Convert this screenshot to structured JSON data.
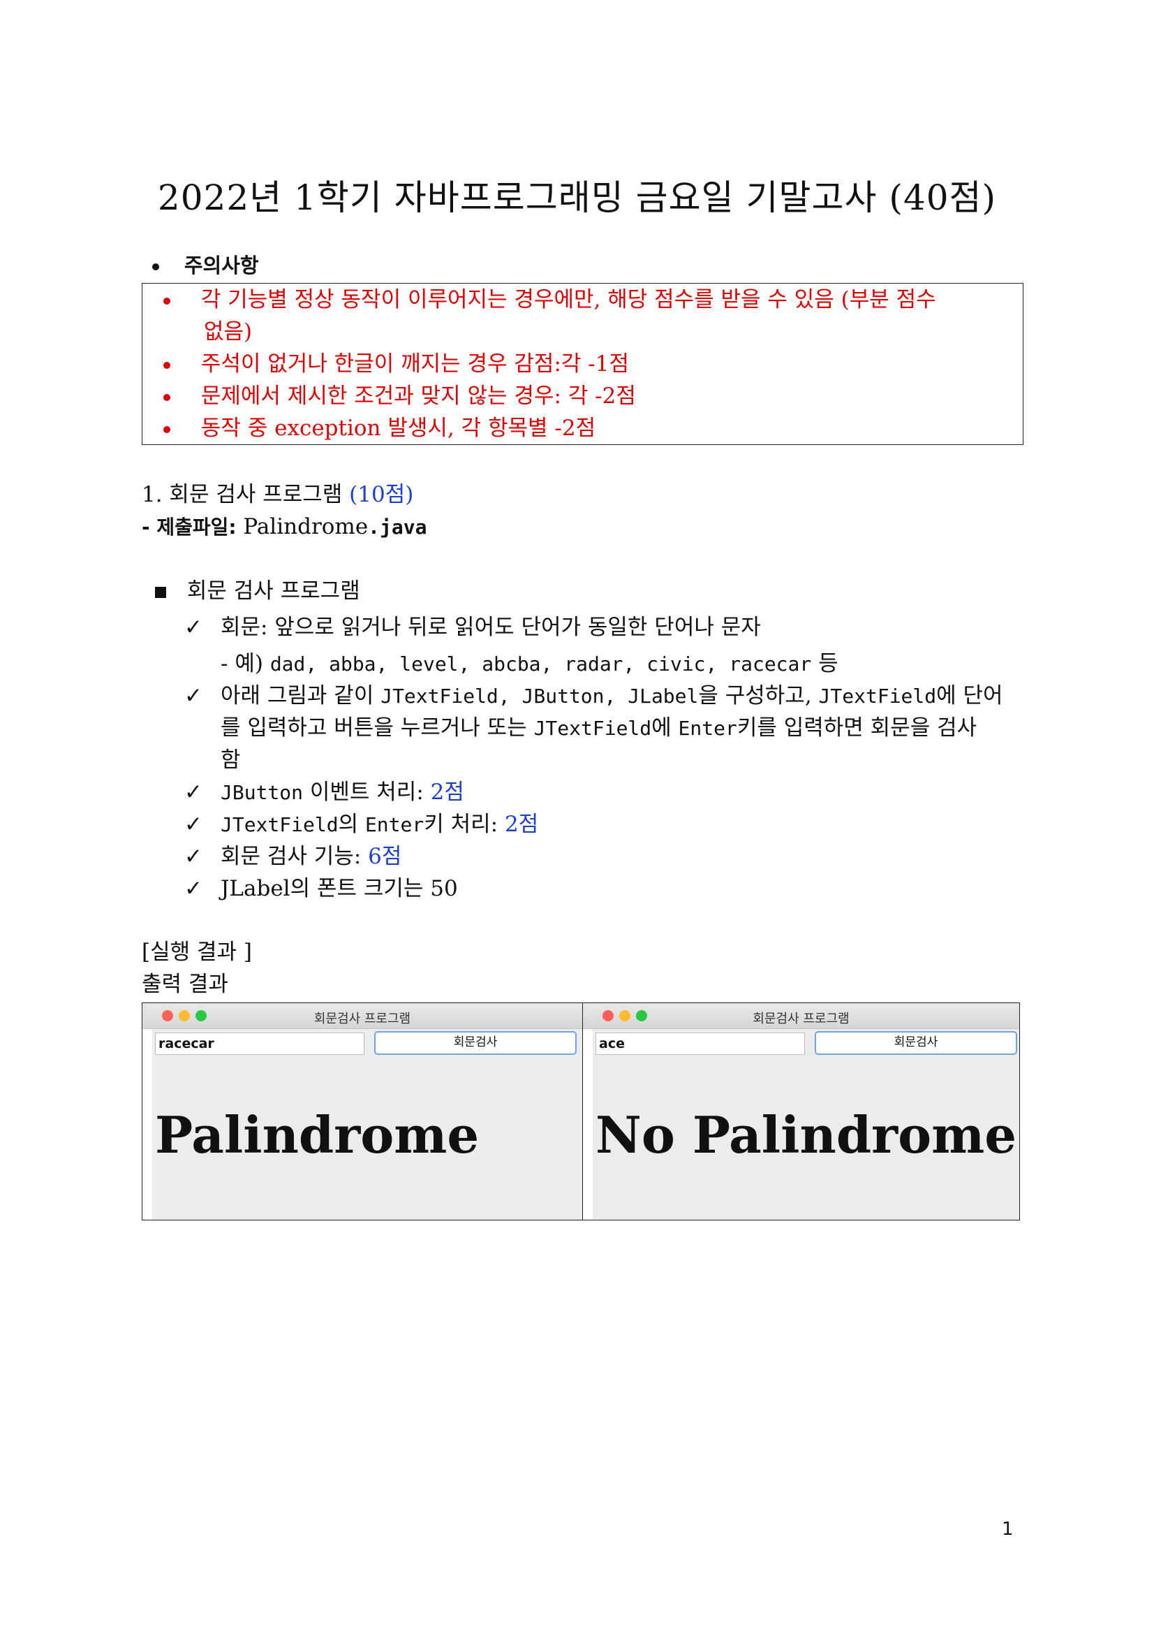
{
  "title": "2022년 1학기 자바프로그래밍 금요일 기말고사 (40점)",
  "notice": {
    "heading": "주의사항",
    "items": [
      "각 기능별 정상 동작이 이루어지는 경우에만, 해당 점수를 받을 수 있음 (부분 점수",
      "없음)",
      "주석이 없거나 한글이 깨지는 경우 감점:각 -1점",
      "문제에서 제시한 조건과 맞지 않는 경우: 각 -2점",
      "동작 중 exception 발생시, 각 항목별 -2점"
    ]
  },
  "q1": {
    "number": "1. 회문 검사 프로그램",
    "points": "(10점)",
    "file_prefix": "- 제출파일: ",
    "file_name": "Palindrome",
    "file_ext": ".java",
    "section": "회문 검사 프로그램",
    "def": "회문: 앞으로 읽거나 뒤로 읽어도 단어가 동일한 단어나 문자",
    "example_prefix": "-    예)",
    "example_words": "dad, abba, level, abcba, radar, civic, racecar",
    "example_suffix": "등",
    "req_line1_a": "아래 그림과 같이",
    "req_line1_code": "JTextField, JButton, JLabel",
    "req_line1_b": "을 구성하고,",
    "req_line1_code2": "JTextField",
    "req_line1_c": "에 단어",
    "req_line2_a": "를 입력하고 버튼을 누르거나 또는",
    "req_line2_code": "JTextField",
    "req_line2_b": "에",
    "req_line2_code2": "Enter",
    "req_line2_c": "키를 입력하면 회문을 검사",
    "req_line3": "함",
    "scoring": [
      {
        "code": "JButton",
        "text": " 이벤트 처리: ",
        "pts": "2점"
      },
      {
        "code": "JTextField",
        "text": "의 ",
        "code2": "Enter",
        "text2": "키 처리: ",
        "pts": "2점"
      },
      {
        "text": "회문 검사 기능: ",
        "pts": "6점"
      },
      {
        "text": "JLabel의 폰트 크기는 50"
      }
    ]
  },
  "result": {
    "heading": "[실행 결과 ]",
    "sub": "출력 결과",
    "windows": [
      {
        "title": "회문검사 프로그램",
        "input": "racecar",
        "button": "회문검사",
        "label": "Palindrome"
      },
      {
        "title": "회문검사 프로그램",
        "input": "ace",
        "button": "회문검사",
        "label": "No Palindrome"
      }
    ]
  },
  "page_number": "1"
}
